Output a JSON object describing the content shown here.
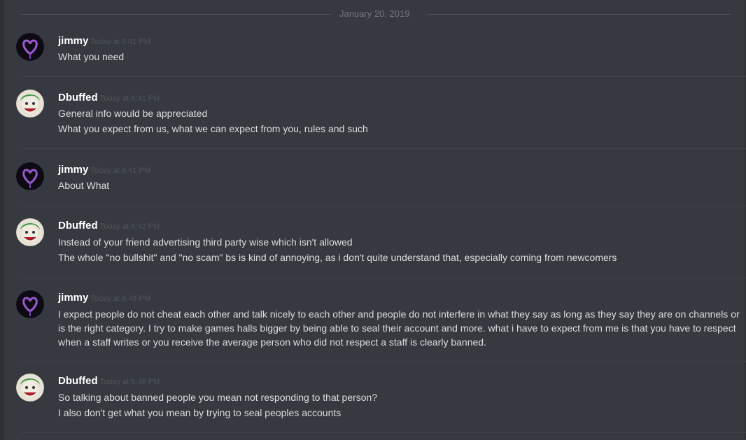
{
  "date_divider": "January 20, 2019",
  "messages": [
    {
      "user": "jimmy",
      "time": "Today at 6:41 PM",
      "avatar": "purple-heart-avatar",
      "lines": [
        "What you need"
      ]
    },
    {
      "user": "Dbuffed",
      "time": "Today at 6:41 PM",
      "avatar": "joker-avatar",
      "lines": [
        "General info would be appreciated",
        "What you expect from us, what we can expect from you, rules and such"
      ]
    },
    {
      "user": "jimmy",
      "time": "Today at 6:41 PM",
      "avatar": "purple-heart-avatar",
      "lines": [
        "About What"
      ]
    },
    {
      "user": "Dbuffed",
      "time": "Today at 6:42 PM",
      "avatar": "joker-avatar",
      "lines": [
        "Instead of your friend advertising third party wise which isn't allowed",
        "The whole \"no bullshit\" and \"no scam\" bs is kind of annoying, as i don't quite understand that, especially coming from newcomers"
      ]
    },
    {
      "user": "jimmy",
      "time": "Today at 6:48 PM",
      "avatar": "purple-heart-avatar",
      "lines": [
        "I expect people do not cheat each other and talk nicely to each other and people do not interfere in what they say as long as they say they are on channels or is the right category. I try to make games halls bigger by being able to seal their account and more. what i have to expect from me is that you have to respect when a staff writes or you receive the average person who did not respect a staff is clearly banned."
      ]
    },
    {
      "user": "Dbuffed",
      "time": "Today at 6:49 PM",
      "avatar": "joker-avatar",
      "lines": [
        "So talking about banned people you mean not responding to that person?",
        "I also don't get what you mean by trying to seal peoples accounts"
      ]
    }
  ],
  "colors": {
    "background": "#36393f",
    "username": "#ffffff",
    "timestamp": "#4f545c",
    "message_text": "#dcddde"
  }
}
